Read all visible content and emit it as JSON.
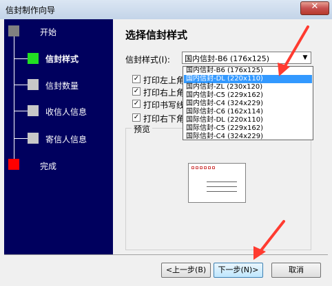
{
  "window": {
    "title": "信封制作向导",
    "close_glyph": "✕"
  },
  "sidebar": {
    "steps": [
      {
        "label": "开始",
        "color": "#808080"
      },
      {
        "label": "信封样式",
        "color": "#22e022"
      },
      {
        "label": "信封数量",
        "color": "#c8c8c8"
      },
      {
        "label": "收信人信息",
        "color": "#c8c8c8"
      },
      {
        "label": "寄信人信息",
        "color": "#c8c8c8"
      },
      {
        "label": "完成",
        "color": "#ff0000"
      }
    ]
  },
  "main": {
    "heading": "选择信封样式",
    "style_label": "信封样式(I):",
    "selected_style": "国内信封-B6 (176x125)",
    "checkboxes": [
      {
        "label": "打印左上角",
        "checked": true
      },
      {
        "label": "打印右上角",
        "checked": true
      },
      {
        "label": "打印书写线",
        "checked": true
      },
      {
        "label": "打印右下角",
        "checked": true
      }
    ],
    "preview_label": "预览"
  },
  "dropdown": {
    "options": [
      "国内信封-B6 (176x125)",
      "国内信封-DL (220x110)",
      "国内信封-ZL (230x120)",
      "国内信封-C5 (229x162)",
      "国内信封-C4 (324x229)",
      "国际信封-C6 (162x114)",
      "国际信封-DL (220x110)",
      "国际信封-C5 (229x162)",
      "国际信封-C4 (324x229)"
    ],
    "highlighted": "国内信封-DL (220x110)"
  },
  "buttons": {
    "back": "<上一步(B)",
    "next": "下一步(N)>",
    "cancel": "取消"
  },
  "colors": {
    "sidebar_bg": "#00005e",
    "highlight": "#3399ff",
    "annotation_arrow": "#ff3b30"
  }
}
